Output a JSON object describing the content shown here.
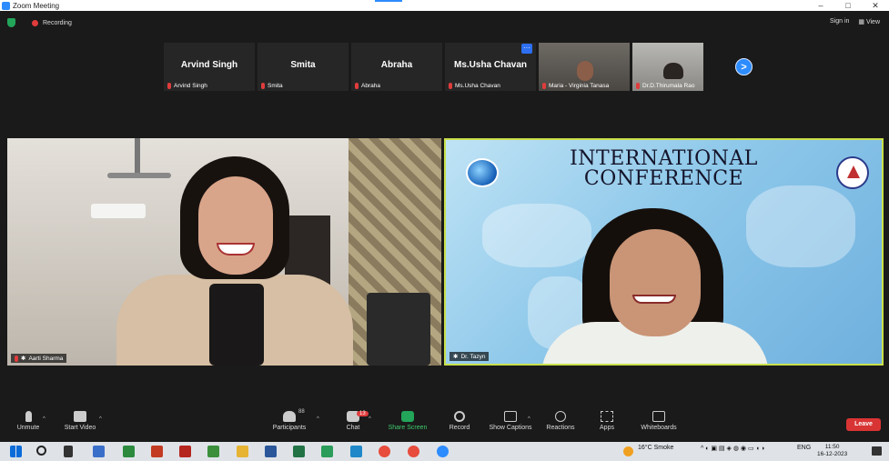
{
  "window": {
    "title": "Zoom Meeting",
    "minimize": "–",
    "restore": "□",
    "close": "✕"
  },
  "topbar": {
    "recording": "Recording",
    "sign_in": "Sign in",
    "view": "View"
  },
  "thumbnails": [
    {
      "display_name": "Arvind Singh",
      "label": "Arvind Singh",
      "video": false
    },
    {
      "display_name": "Smita",
      "label": "Smita",
      "video": false
    },
    {
      "display_name": "Abraha",
      "label": "Abraha",
      "video": false
    },
    {
      "display_name": "Ms.Usha Chavan",
      "label": "Ms.Usha Chavan",
      "video": false
    },
    {
      "display_name": "",
      "label": "Maria - Virginia Tanasa",
      "video": true
    },
    {
      "display_name": "",
      "label": "Dr.D.Thirumala Rao",
      "video": true
    }
  ],
  "thumb_more": "···",
  "next_page": ">",
  "main_videos": {
    "left": {
      "name": "Aarti Sharma"
    },
    "right": {
      "name": "Dr. Tazyn",
      "banner_line1": "INTERNATIONAL",
      "banner_line2": "CONFERENCE"
    }
  },
  "controls": {
    "unmute": "Unmute",
    "start_video": "Start Video",
    "participants": "Participants",
    "participants_count": "88",
    "chat": "Chat",
    "chat_badge": "13",
    "share_screen": "Share Screen",
    "record": "Record",
    "show_captions": "Show Captions",
    "reactions": "Reactions",
    "apps": "Apps",
    "whiteboards": "Whiteboards",
    "leave": "Leave"
  },
  "taskbar": {
    "weather": "16°C  Smoke",
    "language": "ENG",
    "time": "11:50",
    "date": "16-12-2023"
  },
  "colors": {
    "zoom_blue": "#2d8cff",
    "leave_red": "#d93434",
    "active_speaker": "#c9e04a",
    "share_green": "#23a55a"
  }
}
